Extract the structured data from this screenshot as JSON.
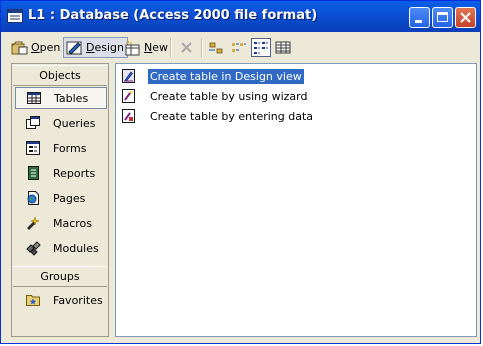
{
  "window": {
    "title": "L1 : Database (Access 2000 file format)"
  },
  "toolbar": {
    "open_label": "Open",
    "design_label": "Design",
    "new_label": "New",
    "open_access_key": "O",
    "design_access_key": "D",
    "new_access_key": "N"
  },
  "objects_bar": {
    "objects_header": "Objects",
    "items": [
      {
        "label": "Tables",
        "icon": "table-icon",
        "selected": true
      },
      {
        "label": "Queries",
        "icon": "query-icon"
      },
      {
        "label": "Forms",
        "icon": "form-icon"
      },
      {
        "label": "Reports",
        "icon": "report-icon"
      },
      {
        "label": "Pages",
        "icon": "page-icon"
      },
      {
        "label": "Macros",
        "icon": "macro-icon"
      },
      {
        "label": "Modules",
        "icon": "module-icon"
      }
    ],
    "groups_header": "Groups",
    "group_items": [
      {
        "label": "Favorites",
        "icon": "favorites-icon"
      }
    ]
  },
  "list": {
    "items": [
      {
        "label": "Create table in Design view",
        "icon": "design-view-shortcut-icon",
        "selected": true
      },
      {
        "label": "Create table by using wizard",
        "icon": "wizard-shortcut-icon"
      },
      {
        "label": "Create table by entering data",
        "icon": "datasheet-shortcut-icon"
      }
    ]
  },
  "colors": {
    "titlebar": "#0b4fd2",
    "selection": "#316ac5",
    "close_button": "#c4412a",
    "panel": "#ece9d8"
  }
}
